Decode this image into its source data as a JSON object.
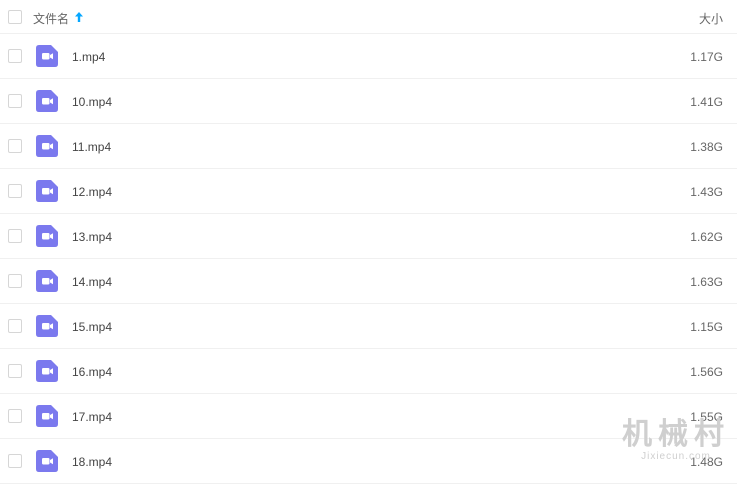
{
  "header": {
    "name_label": "文件名",
    "size_label": "大小",
    "sort_icon": "arrow-up-icon"
  },
  "files": [
    {
      "name": "1.mp4",
      "size": "1.17G",
      "icon": "video-file-icon"
    },
    {
      "name": "10.mp4",
      "size": "1.41G",
      "icon": "video-file-icon"
    },
    {
      "name": "11.mp4",
      "size": "1.38G",
      "icon": "video-file-icon"
    },
    {
      "name": "12.mp4",
      "size": "1.43G",
      "icon": "video-file-icon"
    },
    {
      "name": "13.mp4",
      "size": "1.62G",
      "icon": "video-file-icon"
    },
    {
      "name": "14.mp4",
      "size": "1.63G",
      "icon": "video-file-icon"
    },
    {
      "name": "15.mp4",
      "size": "1.15G",
      "icon": "video-file-icon"
    },
    {
      "name": "16.mp4",
      "size": "1.56G",
      "icon": "video-file-icon"
    },
    {
      "name": "17.mp4",
      "size": "1.55G",
      "icon": "video-file-icon"
    },
    {
      "name": "18.mp4",
      "size": "1.48G",
      "icon": "video-file-icon"
    }
  ],
  "watermark": {
    "main": "机械村",
    "sub": "Jixiecun.com"
  },
  "colors": {
    "icon_purple": "#7b79ee",
    "sort_arrow": "#06a7ff"
  }
}
